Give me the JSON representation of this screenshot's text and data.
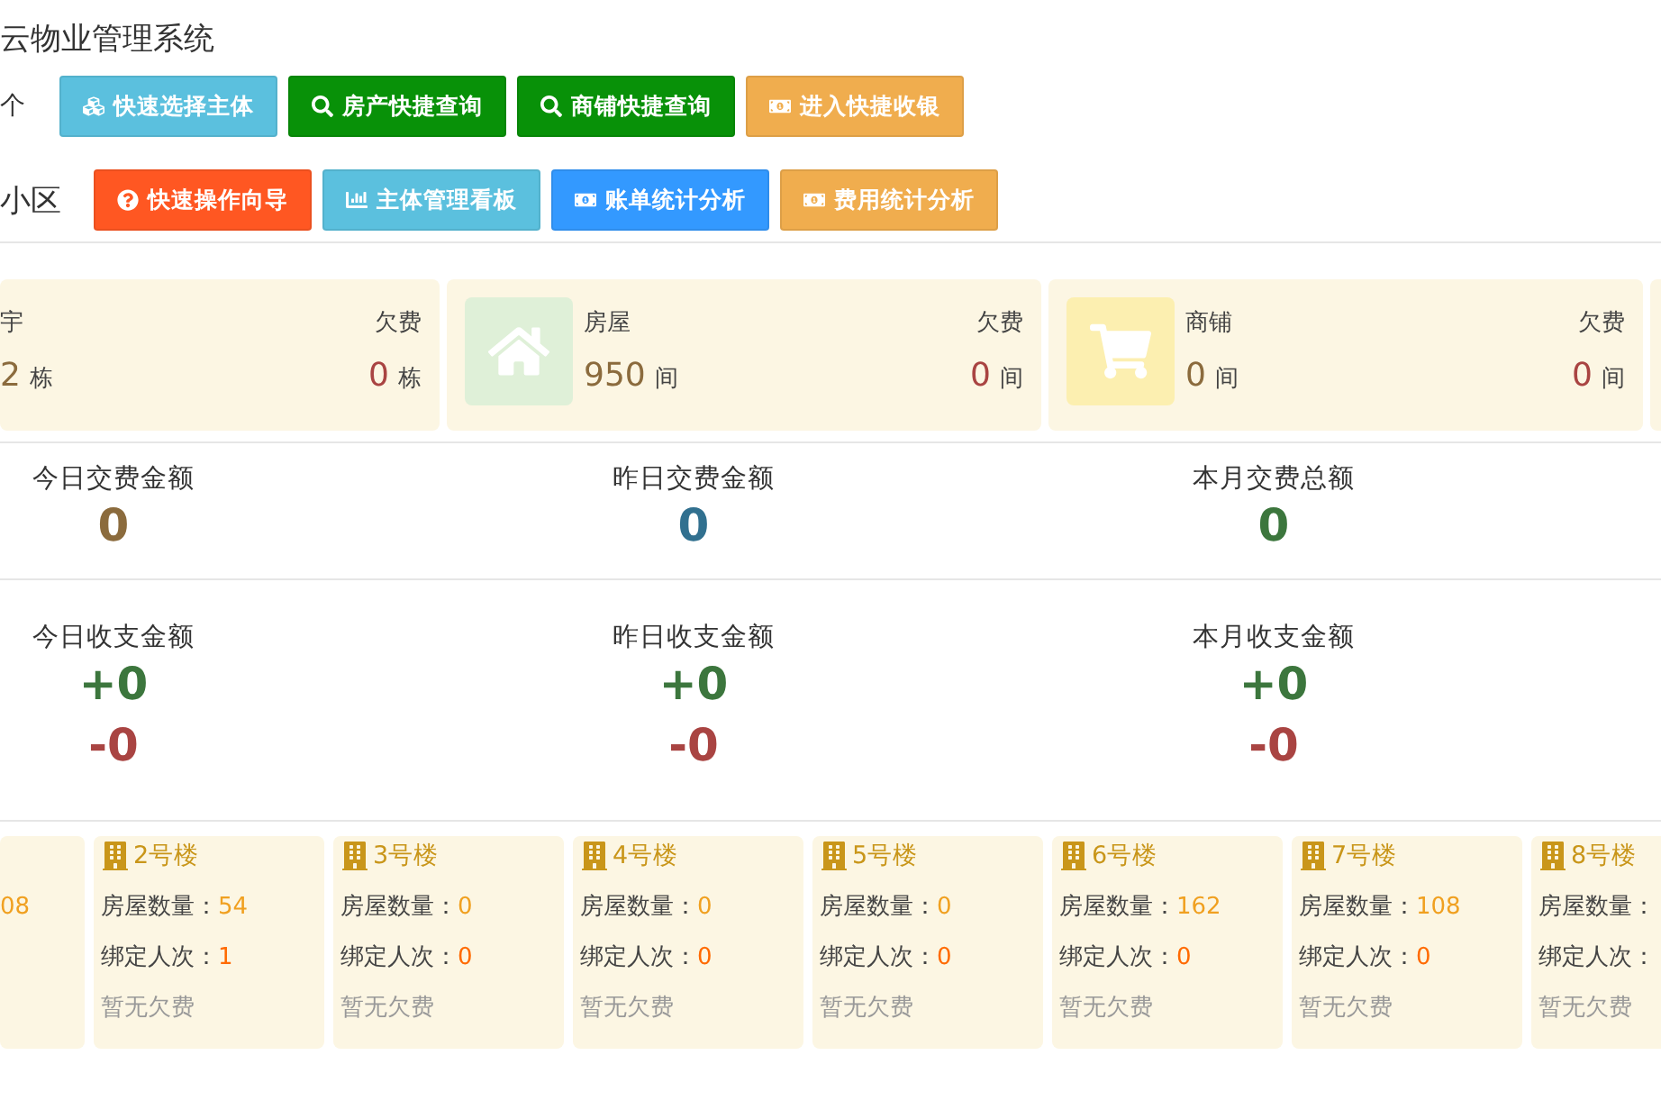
{
  "header": {
    "title": "云物业管理系统",
    "rows": [
      {
        "label": "个",
        "buttons": [
          {
            "text": "快速选择主体",
            "color": "#5bc0de",
            "kind": "cubes"
          },
          {
            "text": "房产快捷查询",
            "color": "#089108",
            "kind": "search"
          },
          {
            "text": "商铺快捷查询",
            "color": "#089108",
            "kind": "search"
          },
          {
            "text": "进入快捷收银",
            "color": "#f0ad4e",
            "kind": "money"
          }
        ]
      },
      {
        "label": "小区",
        "buttons": [
          {
            "text": "快速操作向导",
            "color": "#ff5722",
            "kind": "question"
          },
          {
            "text": "主体管理看板",
            "color": "#5bc0de",
            "kind": "chart"
          },
          {
            "text": "账单统计分析",
            "color": "#3399ff",
            "kind": "money"
          },
          {
            "text": "费用统计分析",
            "color": "#f0ad4e",
            "kind": "money"
          }
        ]
      }
    ]
  },
  "summary_cards": [
    {
      "kind": "clipped",
      "label": "宇",
      "count": "2",
      "unit": "栋",
      "owed_label": "欠费",
      "owed": "0",
      "owed_unit": "栋"
    },
    {
      "kind": "house",
      "label": "房屋",
      "count": "950",
      "unit": "间",
      "owed_label": "欠费",
      "owed": "0",
      "owed_unit": "间"
    },
    {
      "kind": "cart",
      "label": "商铺",
      "count": "0",
      "unit": "间",
      "owed_label": "欠费",
      "owed": "0",
      "owed_unit": "间"
    },
    {
      "kind": "sliver"
    }
  ],
  "payments": [
    {
      "label": "今日交费金额",
      "value": "0",
      "color": "#8b6b3d"
    },
    {
      "label": "昨日交费金额",
      "value": "0",
      "color": "#31708f"
    },
    {
      "label": "本月交费总额",
      "value": "0",
      "color": "#3c763d"
    }
  ],
  "balances": [
    {
      "label": "今日收支金额",
      "income": "+0",
      "expense": "-0"
    },
    {
      "label": "昨日收支金额",
      "income": "+0",
      "expense": "-0"
    },
    {
      "label": "本月收支金额",
      "income": "+0",
      "expense": "-0"
    }
  ],
  "buildings": [
    {
      "kind": "clipped",
      "houses": "08"
    },
    {
      "kind": "full",
      "name": "2号楼",
      "houses_label": "房屋数量：",
      "houses": "54",
      "bound_label": "绑定人次：",
      "bound": "1",
      "note": "暂无欠费"
    },
    {
      "kind": "full",
      "name": "3号楼",
      "houses_label": "房屋数量：",
      "houses": "0",
      "bound_label": "绑定人次：",
      "bound": "0",
      "note": "暂无欠费"
    },
    {
      "kind": "full",
      "name": "4号楼",
      "houses_label": "房屋数量：",
      "houses": "0",
      "bound_label": "绑定人次：",
      "bound": "0",
      "note": "暂无欠费"
    },
    {
      "kind": "full",
      "name": "5号楼",
      "houses_label": "房屋数量：",
      "houses": "0",
      "bound_label": "绑定人次：",
      "bound": "0",
      "note": "暂无欠费"
    },
    {
      "kind": "full",
      "name": "6号楼",
      "houses_label": "房屋数量：",
      "houses": "162",
      "bound_label": "绑定人次：",
      "bound": "0",
      "note": "暂无欠费"
    },
    {
      "kind": "full",
      "name": "7号楼",
      "houses_label": "房屋数量：",
      "houses": "108",
      "bound_label": "绑定人次：",
      "bound": "0",
      "note": "暂无欠费"
    },
    {
      "kind": "full",
      "name": "8号楼",
      "houses_label": "房屋数量：",
      "bound_label": "绑定人次：",
      "note": "暂无欠费"
    }
  ]
}
